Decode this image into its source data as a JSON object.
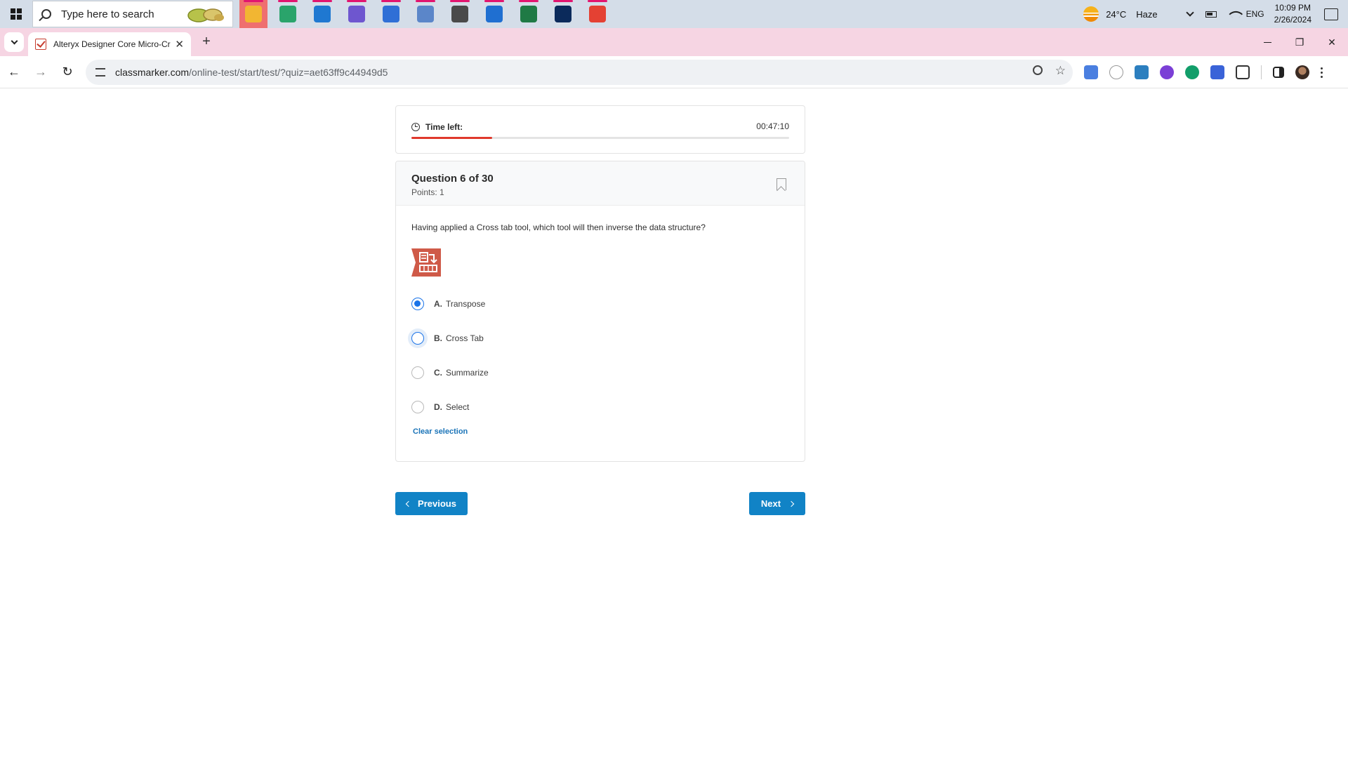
{
  "taskbar": {
    "search_placeholder": "Type here to search",
    "apps": [
      {
        "name": "file-explorer",
        "color": "#f2b632",
        "active": true
      },
      {
        "name": "edge",
        "color": "#2aa46b",
        "active": false
      },
      {
        "name": "mail",
        "color": "#1f78d1",
        "active": false
      },
      {
        "name": "copilot",
        "color": "#6e56cf",
        "active": false
      },
      {
        "name": "azure-devops",
        "color": "#2f6fd6",
        "active": false
      },
      {
        "name": "document-user",
        "color": "#5b86c9",
        "active": false
      },
      {
        "name": "settings",
        "color": "#4a4a4a",
        "active": false
      },
      {
        "name": "photos",
        "color": "#1f6fd1",
        "active": false
      },
      {
        "name": "excel",
        "color": "#1f7a45",
        "active": false
      },
      {
        "name": "power-automate-desktop",
        "color": "#0b2a5b",
        "active": false
      },
      {
        "name": "chrome",
        "color": "#e44133",
        "active": false
      }
    ],
    "weather_temp": "24°C",
    "weather_desc": "Haze",
    "language": "ENG",
    "time": "10:09 PM",
    "date": "2/26/2024"
  },
  "browser": {
    "tab_title": "Alteryx Designer Core Micro-Cr",
    "url_host": "classmarker.com",
    "url_path": "/online-test/start/test/?quiz=aet63ff9c44949d5"
  },
  "timer": {
    "label": "Time left:",
    "value": "00:47:10",
    "progress_fraction": 0.213,
    "progress_color": "#e0392c"
  },
  "question": {
    "title": "Question 6 of 30",
    "points": "Points: 1",
    "text": "Having applied a Cross tab tool, which tool will then inverse the data structure?",
    "image_icon": "transpose-tool-icon",
    "options": [
      {
        "letter": "A.",
        "text": "Transpose",
        "selected": true
      },
      {
        "letter": "B.",
        "text": "Cross Tab",
        "selected": false,
        "hovered": true
      },
      {
        "letter": "C.",
        "text": "Summarize",
        "selected": false
      },
      {
        "letter": "D.",
        "text": "Select",
        "selected": false
      }
    ],
    "clear_label": "Clear selection"
  },
  "nav": {
    "previous_label": "Previous",
    "next_label": "Next",
    "button_color": "#1183c6"
  }
}
